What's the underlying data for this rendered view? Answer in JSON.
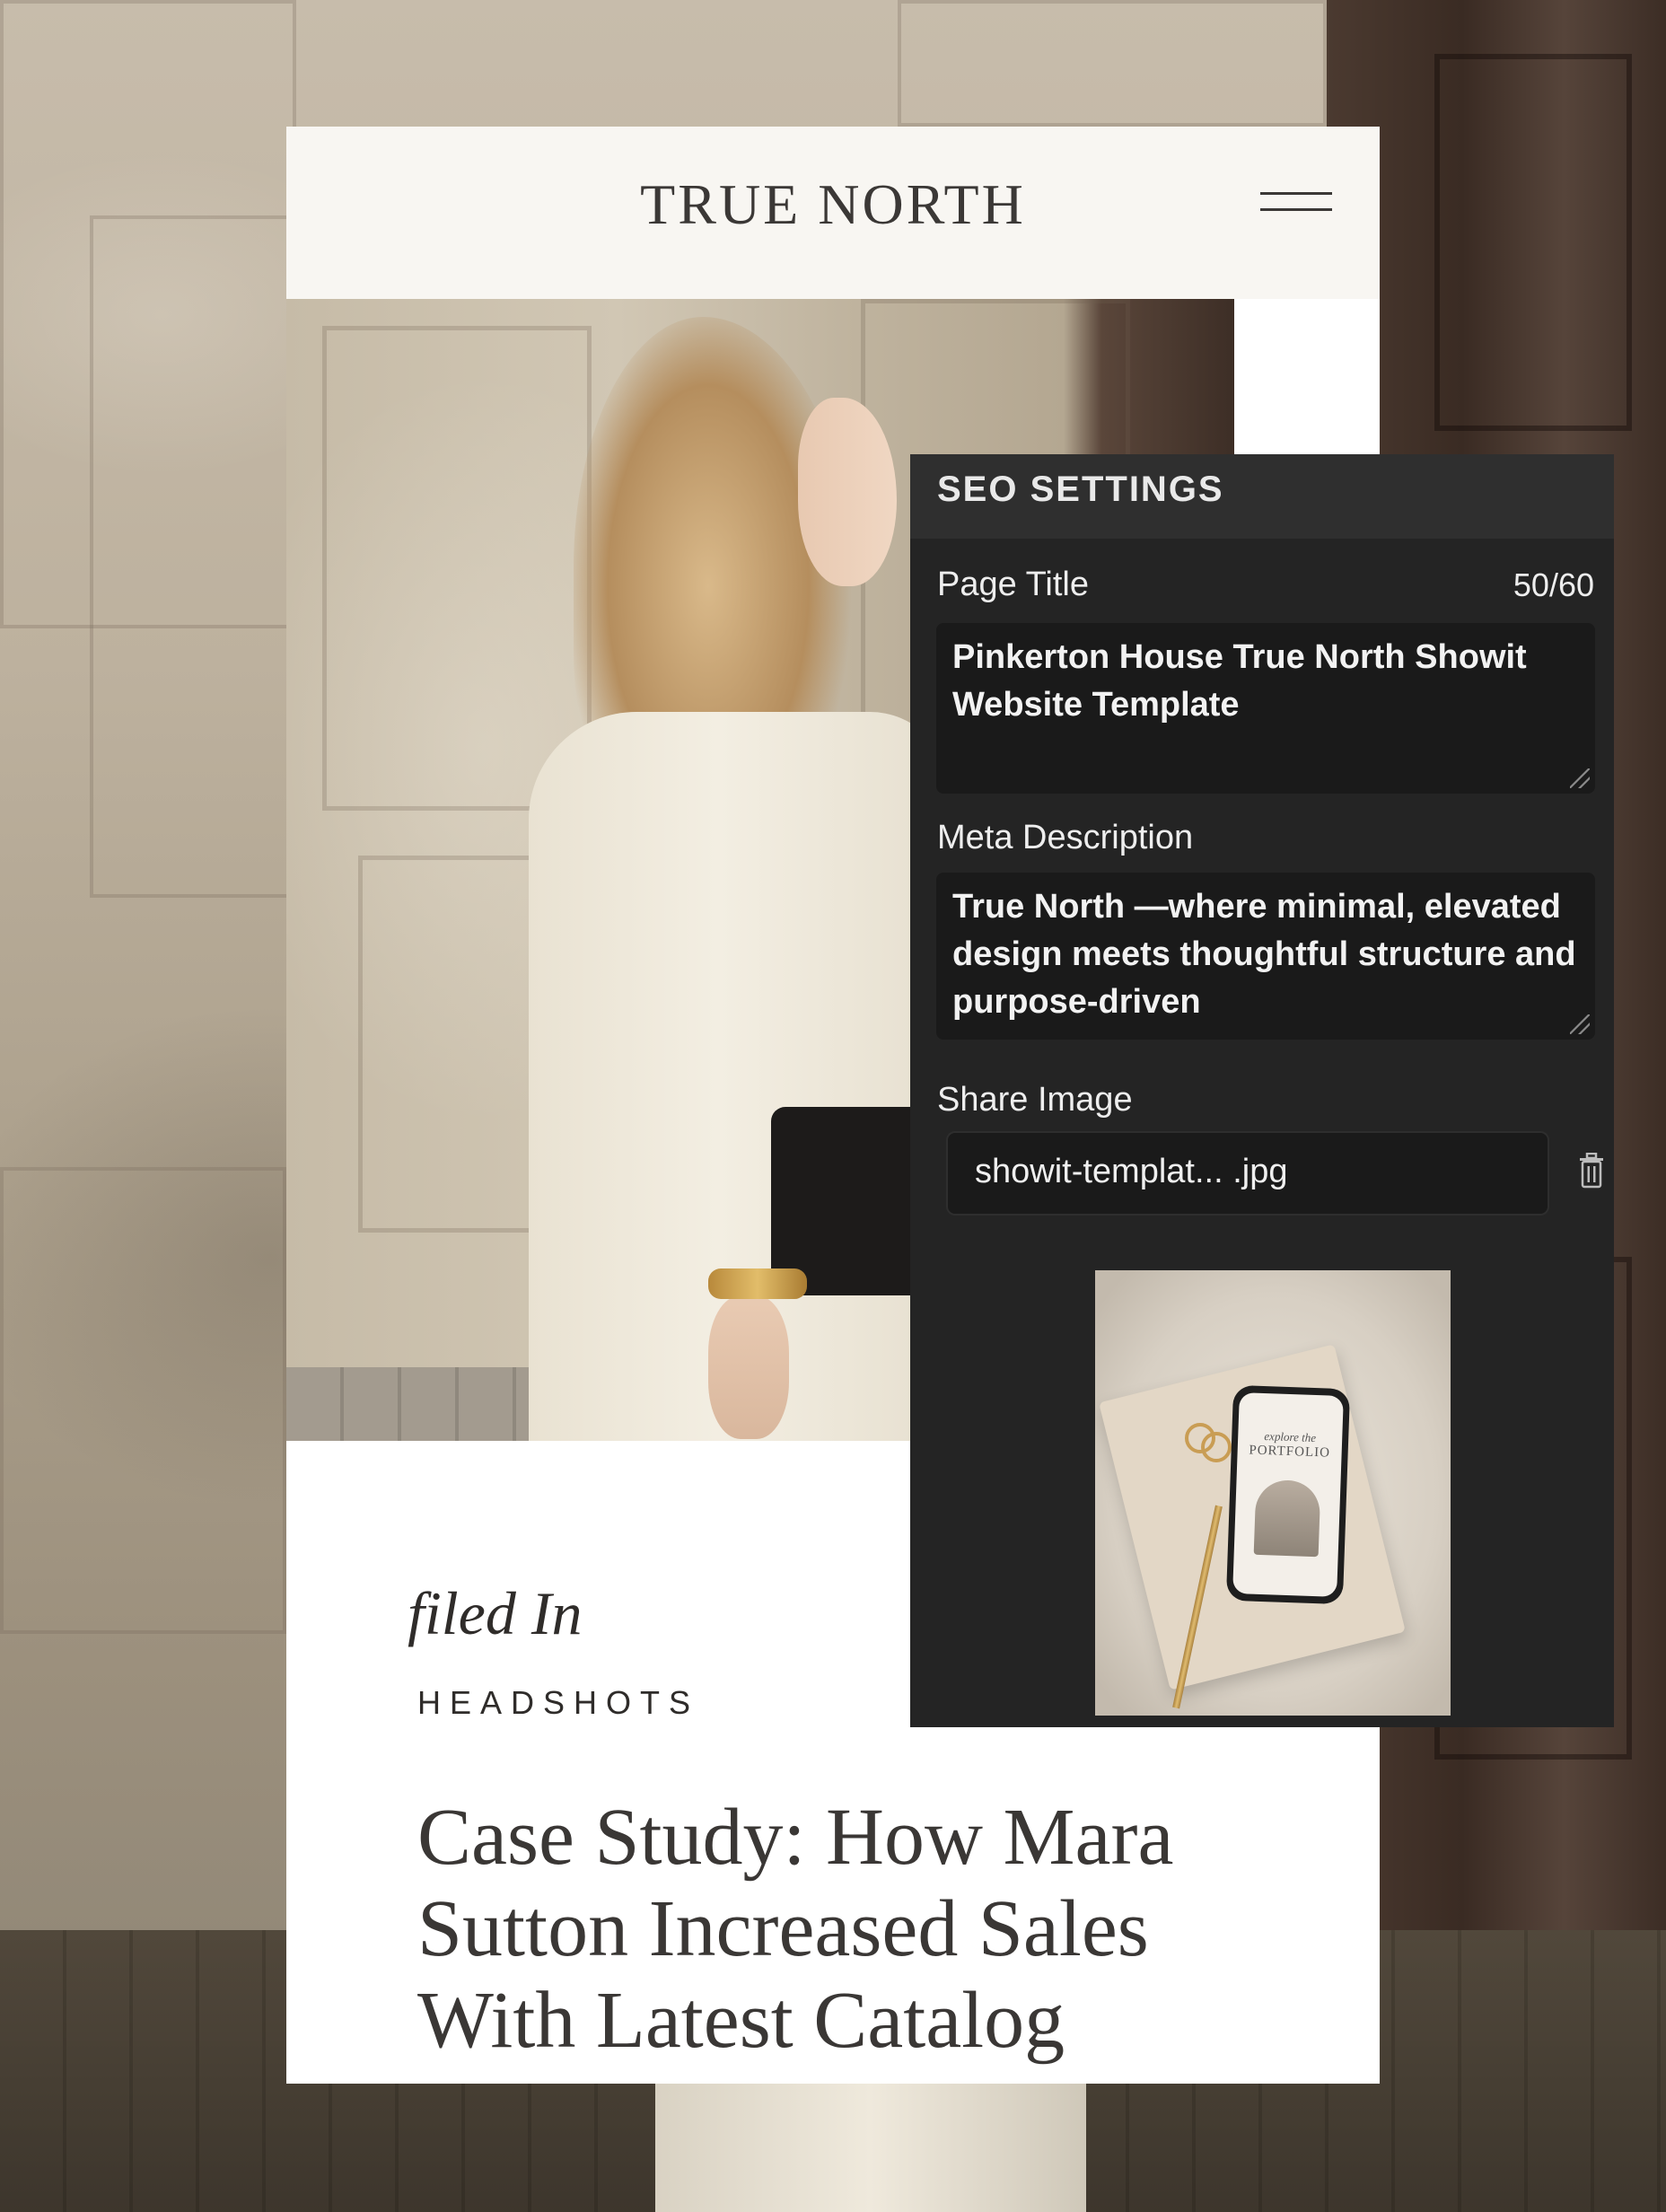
{
  "site": {
    "brand": "TRUE NORTH",
    "filed_label": "filed In",
    "category": "HEADSHOTS",
    "post_title": "Case Study: How Mara Sutton Increased Sales With Latest Catalog"
  },
  "seo_panel": {
    "heading": "SEO SETTINGS",
    "page_title": {
      "label": "Page Title",
      "count": "50/60",
      "value": "Pinkerton House True North Showit Website Template"
    },
    "meta_description": {
      "label": "Meta Description",
      "value": "True North —where minimal, elevated design meets thoughtful structure and purpose-driven"
    },
    "share_image": {
      "label": "Share Image",
      "file_name": "showit-templat... .jpg",
      "thumbnail_icon": "image-thumbnail"
    }
  },
  "thumbnail_phone": {
    "script": "explore the",
    "big": "PORTFOLIO"
  },
  "colors": {
    "panel_bg": "#242424",
    "panel_header_bg": "#2f2f2f",
    "field_bg": "#1a1a1a",
    "site_header_bg": "#f8f6f2",
    "text_dark": "#3b3836"
  }
}
